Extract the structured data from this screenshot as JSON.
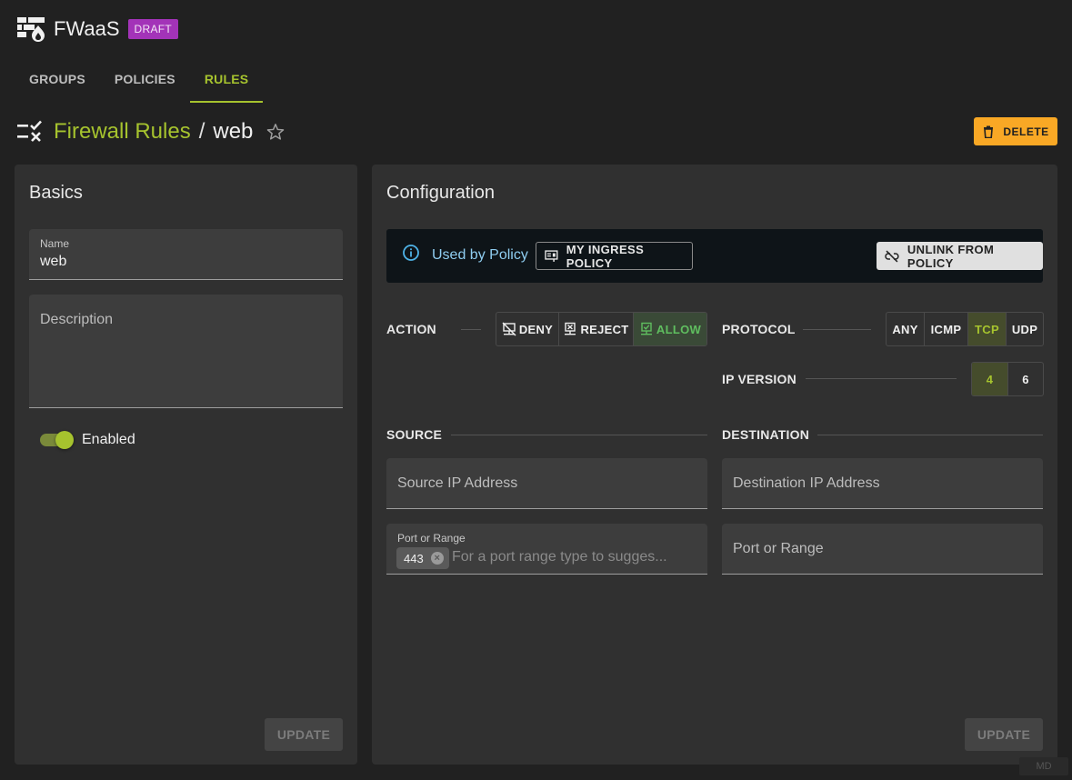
{
  "app": {
    "title": "FWaaS",
    "badge": "DRAFT",
    "logo_icon": "firewall-fire-icon"
  },
  "tabs": [
    {
      "label": "GROUPS"
    },
    {
      "label": "POLICIES"
    },
    {
      "label": "RULES",
      "active": true
    }
  ],
  "breadcrumb": {
    "parent": "Firewall Rules",
    "separator": "/",
    "current": "web"
  },
  "header": {
    "delete_label": "DELETE"
  },
  "basics": {
    "title": "Basics",
    "name_label": "Name",
    "name_value": "web",
    "description_placeholder": "Description",
    "enabled_label": "Enabled",
    "enabled": true,
    "update_label": "UPDATE"
  },
  "config": {
    "title": "Configuration",
    "used_by": "Used by Policy",
    "policy_chip": "MY INGRESS POLICY",
    "unlink_label": "UNLINK FROM POLICY",
    "action_label": "ACTION",
    "actions": [
      {
        "label": "DENY"
      },
      {
        "label": "REJECT"
      },
      {
        "label": "ALLOW",
        "active": true
      }
    ],
    "protocol_label": "PROTOCOL",
    "protocols": [
      {
        "label": "ANY"
      },
      {
        "label": "ICMP"
      },
      {
        "label": "TCP",
        "active": true
      },
      {
        "label": "UDP"
      }
    ],
    "ip_version_label": "IP VERSION",
    "ip_versions": [
      {
        "label": "4",
        "active": true
      },
      {
        "label": "6"
      }
    ],
    "source_label": "SOURCE",
    "destination_label": "DESTINATION",
    "source_ip_placeholder": "Source IP Address",
    "destination_ip_placeholder": "Destination IP Address",
    "source_port_label": "Port or Range",
    "source_port_chip": "443",
    "source_port_placeholder": "For a port range type to sugges...",
    "destination_port_placeholder": "Port or Range",
    "update_label": "UPDATE"
  },
  "footer": {
    "md_badge": "MD"
  },
  "colors": {
    "accent": "#a6c32e",
    "warning": "#f9a825",
    "draft": "#a333b8",
    "info": "#8fcdf0",
    "allow": "#5fbe5f"
  }
}
